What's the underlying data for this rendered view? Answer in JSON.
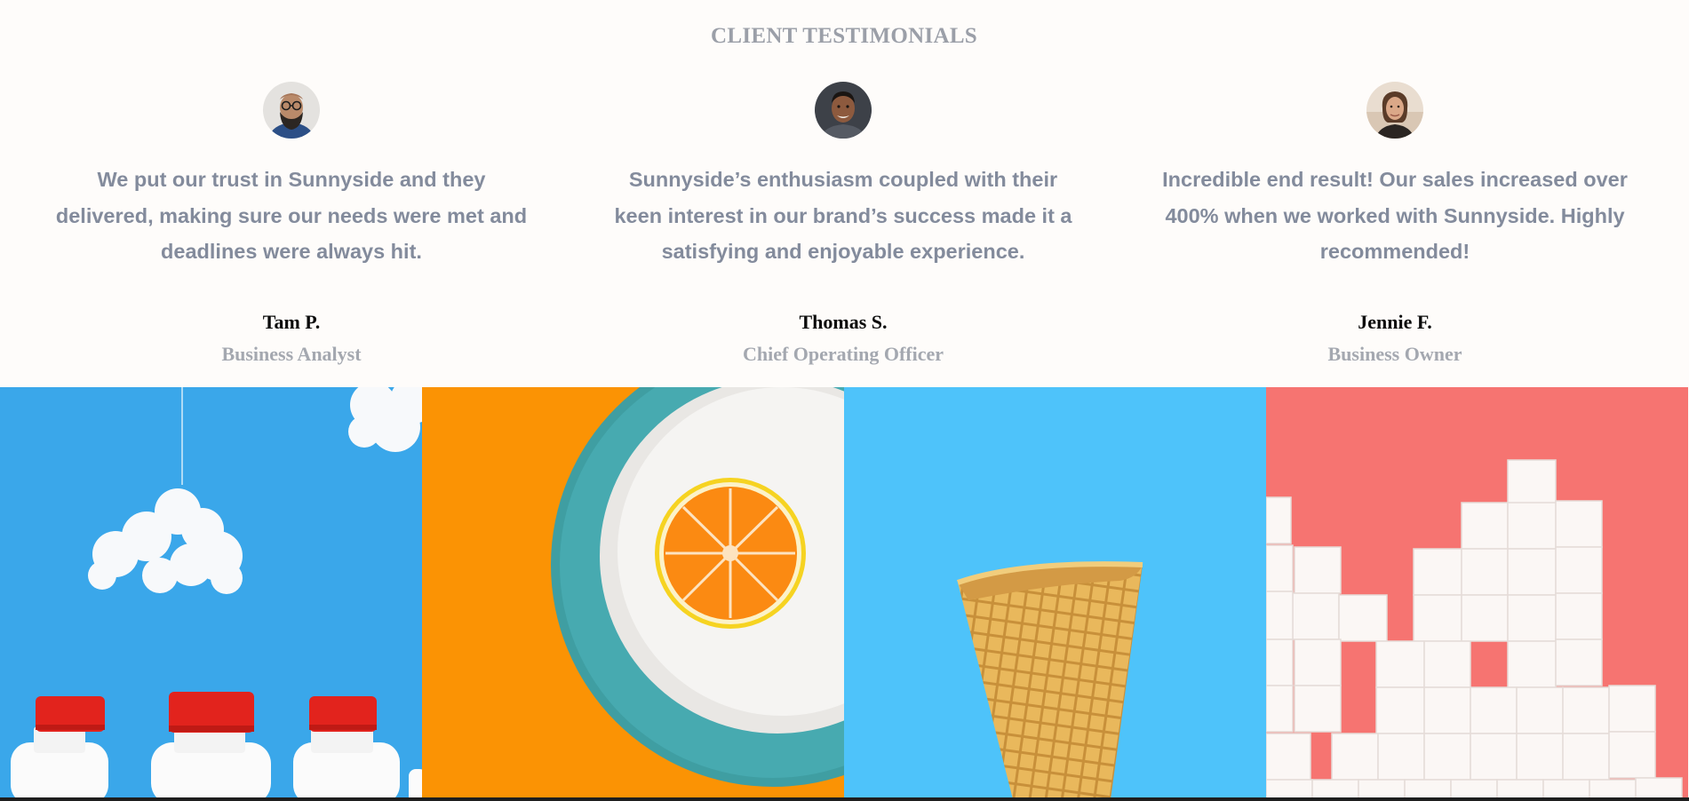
{
  "section": {
    "title": "CLIENT TESTIMONIALS"
  },
  "testimonials": [
    {
      "quote": "We put our trust in Sunnyside and they delivered, making sure our needs were met and deadlines were always hit.",
      "name": "Tam P.",
      "role": "Business Analyst",
      "avatar": "man-with-beard-glasses-avatar"
    },
    {
      "quote": "Sunnyside’s enthusiasm coupled with their keen interest in our brand’s success made it a satisfying and enjoyable experience.",
      "name": "Thomas S.",
      "role": "Chief Operating Officer",
      "avatar": "smiling-man-avatar"
    },
    {
      "quote": "Incredible end result! Our sales increased over 400% when we worked with Sunnyside. Highly recommended!",
      "name": "Jennie F.",
      "role": "Business Owner",
      "avatar": "woman-avatar"
    }
  ],
  "gallery": [
    {
      "subject": "milk-bottles-with-cloud",
      "background": "#3aa7ea"
    },
    {
      "subject": "orange-slice-on-plate",
      "background": "#fb9304"
    },
    {
      "subject": "waffle-cone",
      "background": "#4ec3fa"
    },
    {
      "subject": "sugar-cubes",
      "background": "#f67471"
    }
  ],
  "colors": {
    "page_background": "#fefcfa",
    "title": "#9b9fa8",
    "quote": "#838b9c",
    "name": "#0b0b0b",
    "role": "#a4a8b0"
  }
}
